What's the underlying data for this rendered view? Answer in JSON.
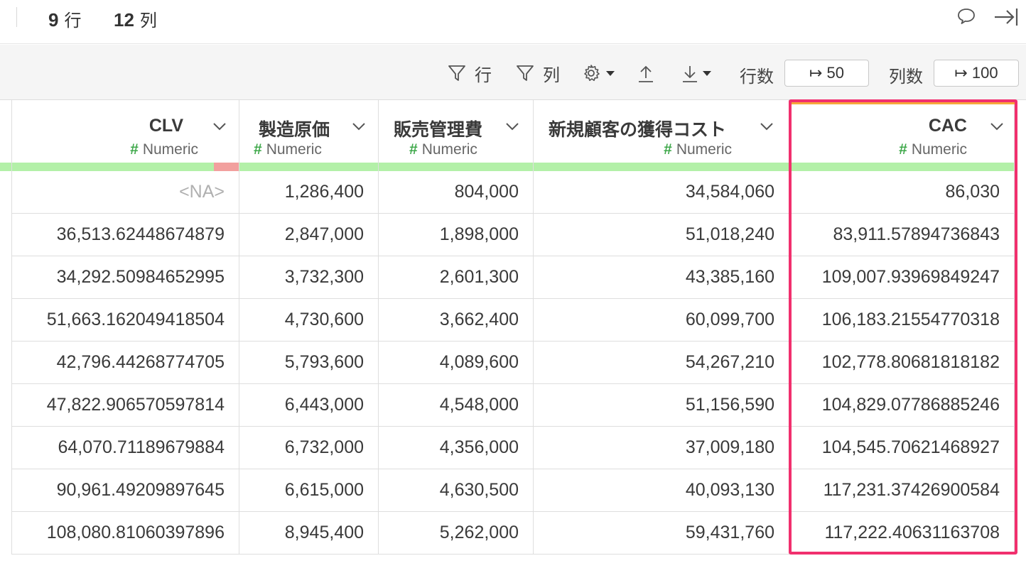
{
  "summary": {
    "rows_count": "9",
    "rows_unit": "行",
    "cols_count": "12",
    "cols_unit": "列"
  },
  "icons": {
    "comment": "comment-icon",
    "collapse": "collapse-right-icon",
    "filter": "filter-icon",
    "gear": "gear-icon",
    "upload": "upload-icon",
    "download": "download-icon"
  },
  "toolbar": {
    "filter_rows_label": "行",
    "filter_cols_label": "列",
    "row_count_label": "行数",
    "row_count_value": "↦ 50",
    "col_count_label": "列数",
    "col_count_value": "↦ 100"
  },
  "colors": {
    "highlight": "#f1306e",
    "numeric_hash": "#3ea84a",
    "quality_ok": "#b3f0a8",
    "quality_missing": "#f2a09e"
  },
  "table": {
    "columns": [
      {
        "name": "CLV",
        "type": "Numeric",
        "missing_fraction": 0.111,
        "cells": [
          "<NA>",
          "36,513.62448674879",
          "34,292.50984652995",
          "51,663.162049418504",
          "42,796.44268774705",
          "47,822.906570597814",
          "64,070.71189679884",
          "90,961.49209897645",
          "108,080.81060397896"
        ]
      },
      {
        "name": "製造原価",
        "type": "Numeric",
        "missing_fraction": 0,
        "cells": [
          "1,286,400",
          "2,847,000",
          "3,732,300",
          "4,730,600",
          "5,793,600",
          "6,443,000",
          "6,732,000",
          "6,615,000",
          "8,945,400"
        ]
      },
      {
        "name": "販売管理費",
        "type": "Numeric",
        "missing_fraction": 0,
        "cells": [
          "804,000",
          "1,898,000",
          "2,601,300",
          "3,662,400",
          "4,089,600",
          "4,548,000",
          "4,356,000",
          "4,630,500",
          "5,262,000"
        ]
      },
      {
        "name": "新規顧客の獲得コスト",
        "type": "Numeric",
        "missing_fraction": 0,
        "cells": [
          "34,584,060",
          "51,018,240",
          "43,385,160",
          "60,099,700",
          "54,267,210",
          "51,156,590",
          "37,009,180",
          "40,093,130",
          "59,431,760"
        ]
      },
      {
        "name": "CAC",
        "type": "Numeric",
        "missing_fraction": 0,
        "cells": [
          "86,030",
          "83,911.57894736843",
          "109,007.93969849247",
          "106,183.21554770318",
          "102,778.80681818182",
          "104,829.07786885246",
          "104,545.70621468927",
          "117,231.37426900584",
          "117,222.40631163708"
        ]
      }
    ]
  }
}
